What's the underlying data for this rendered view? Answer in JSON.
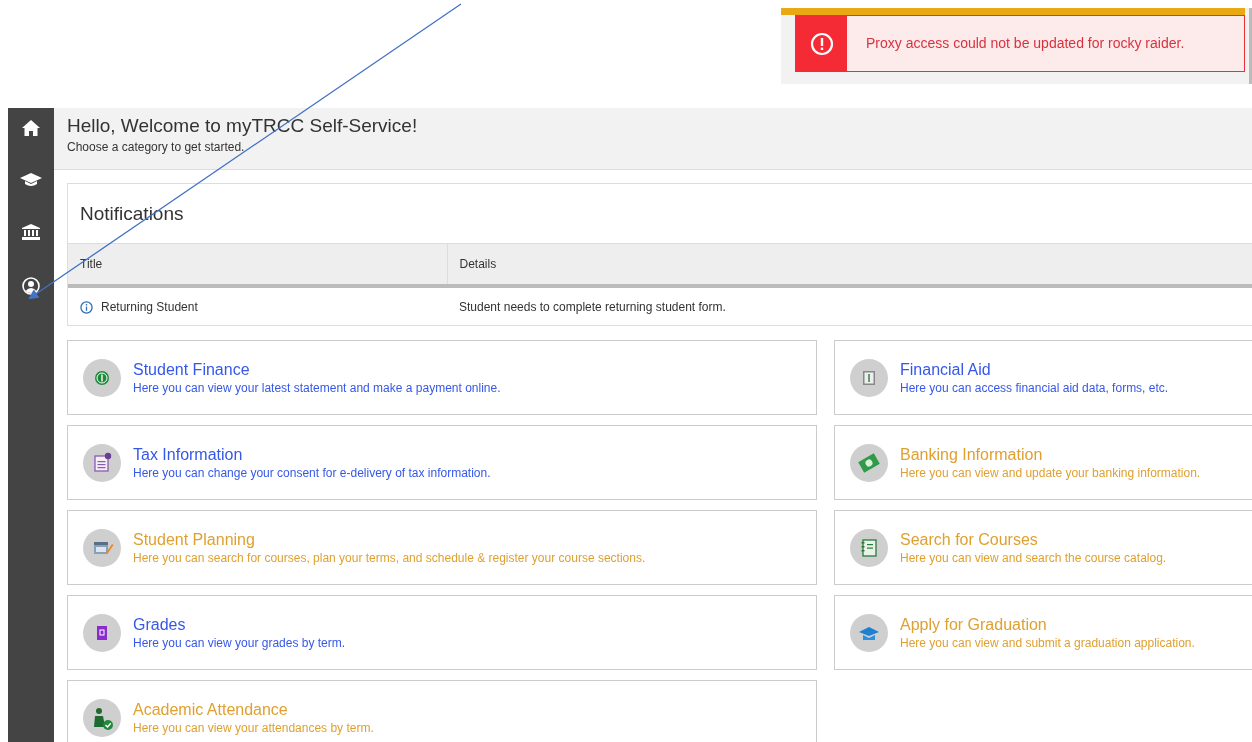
{
  "alert": {
    "message": "Proxy access could not be updated for rocky raider."
  },
  "sidebar": {
    "items": [
      {
        "selected": false
      },
      {
        "selected": false
      },
      {
        "selected": false
      },
      {
        "selected": false
      }
    ]
  },
  "header": {
    "title": "Hello, Welcome to myTRCC Self-Service!",
    "subtitle": "Choose a category to get started."
  },
  "notifications": {
    "title": "Notifications",
    "columns": [
      "Title",
      "Details"
    ],
    "rows": [
      {
        "title": "Returning Student",
        "details": "Student needs to complete returning student form."
      }
    ]
  },
  "tile_rows": [
    [
      {
        "title": "Student Finance",
        "description": "Here you can view your latest statement and make a payment online.",
        "visited": false
      },
      {
        "title": "Financial Aid",
        "description": "Here you can access financial aid data, forms, etc.",
        "visited": false
      }
    ],
    [
      {
        "title": "Tax Information",
        "description": "Here you can change your consent for e-delivery of tax information.",
        "visited": false
      },
      {
        "title": "Banking Information",
        "description": "Here you can view and update your banking information.",
        "visited": true
      }
    ],
    [
      {
        "title": "Student Planning",
        "description": "Here you can search for courses, plan your terms, and schedule & register your course sections.",
        "visited": true
      },
      {
        "title": "Search for Courses",
        "description": "Here you can view and search the course catalog.",
        "visited": true
      }
    ],
    [
      {
        "title": "Grades",
        "description": "Here you can view your grades by term.",
        "visited": false
      },
      {
        "title": "Apply for Graduation",
        "description": "Here you can view and submit a graduation application.",
        "visited": true
      }
    ],
    [
      {
        "title": "Academic Attendance",
        "description": "Here you can view your attendances by term.",
        "visited": true
      }
    ]
  ]
}
